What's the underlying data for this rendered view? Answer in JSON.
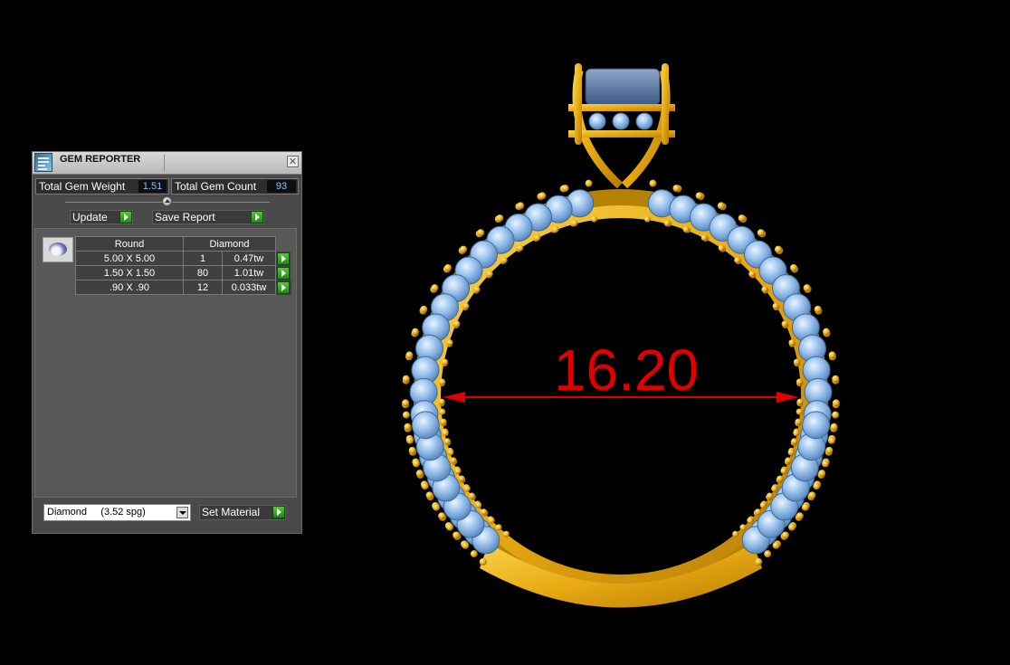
{
  "window": {
    "title": "GEM REPORTER",
    "close_glyph": "✕",
    "icon": "app-icon"
  },
  "stats": {
    "weight_label": "Total Gem Weight",
    "weight_value": "1.51",
    "count_label": "Total Gem Count",
    "count_value": "93"
  },
  "buttons": {
    "update_label": "Update",
    "save_label": "Save Report",
    "set_material_label": "Set Material"
  },
  "gem_table": {
    "shape_header": "Round",
    "type_header": "Diamond",
    "rows": [
      {
        "size": "5.00 X 5.00",
        "count": "1",
        "weight": "0.47tw"
      },
      {
        "size": "1.50 X 1.50",
        "count": "80",
        "weight": "1.01tw"
      },
      {
        "size": ".90 X .90",
        "count": "12",
        "weight": "0.033tw"
      }
    ]
  },
  "material": {
    "selected": "Diamond     (3.52 spg)"
  },
  "viewport": {
    "dimension_label": "16.20",
    "metal_color": "#e8b21a",
    "stone_color": "#8fb8e6",
    "dimension_color": "#e00000"
  }
}
